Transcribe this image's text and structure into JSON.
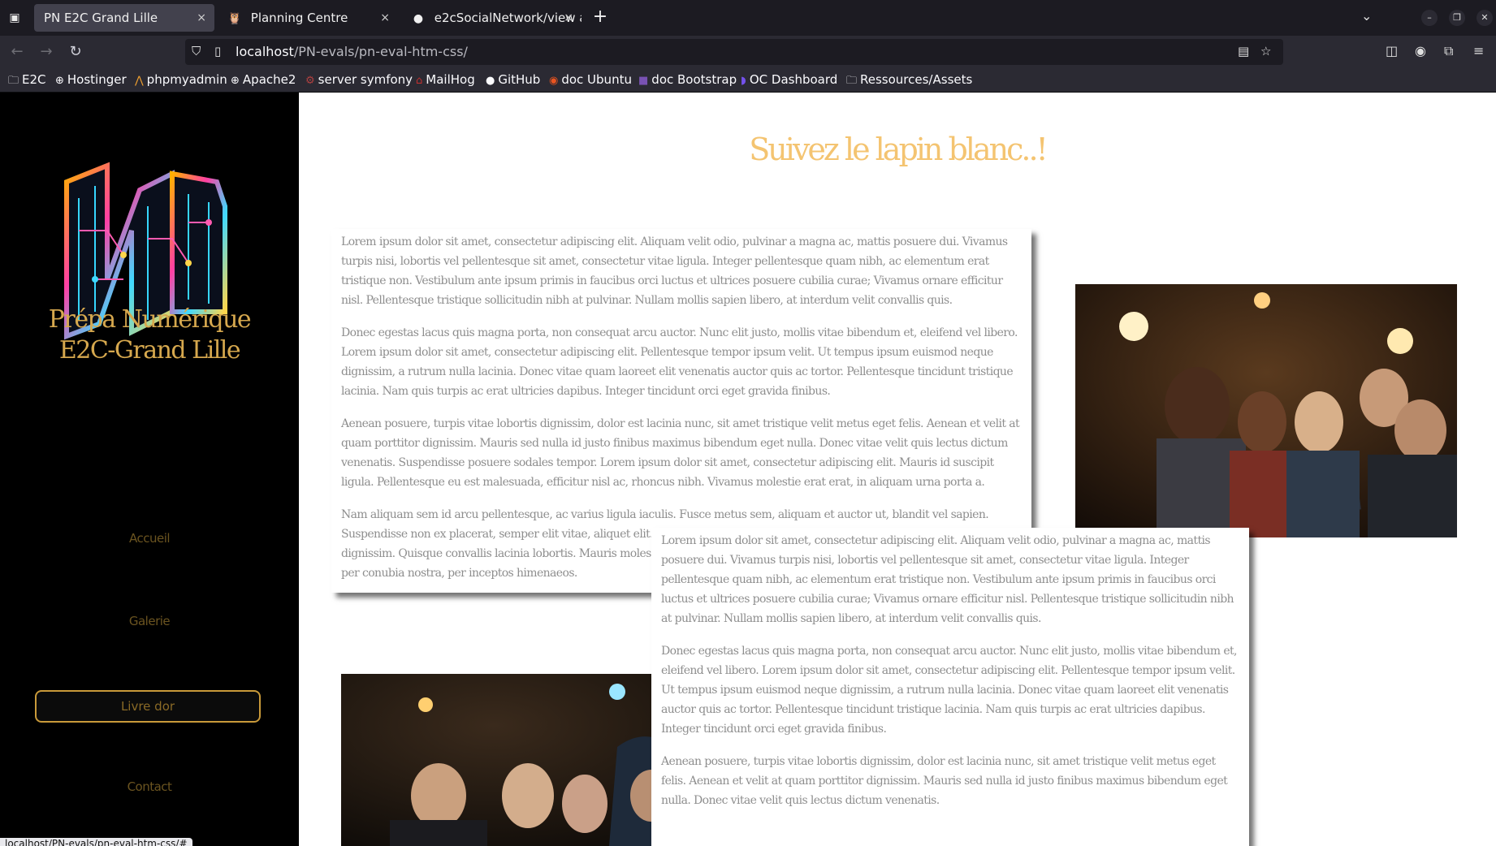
{
  "browser": {
    "tabs": [
      {
        "title": "PN E2C Grand Lille",
        "close": "×"
      },
      {
        "title": "Planning Centre",
        "close": "×"
      },
      {
        "title": "e2cSocialNetwork/view a",
        "close": "×"
      }
    ],
    "new_tab": "+",
    "url_host": "localhost",
    "url_path": "/PN-evals/pn-eval-htm-css/",
    "bookmarks": [
      "E2C",
      "Hostinger",
      "phpmyadmin",
      "Apache2",
      "server symfony",
      "MailHog",
      "GitHub",
      "doc Ubuntu",
      "doc Bootstrap",
      "OC Dashboard",
      "Ressources/Assets"
    ],
    "status_url": "localhost/PN-evals/pn-eval-htm-css/#"
  },
  "sidebar": {
    "brand_line1": "Prépa Numérique",
    "brand_line2": "E2C-Grand Lille",
    "menu": [
      "Accueil",
      "Galerie",
      "Livre dor",
      "Contact"
    ],
    "active_item": "Livre dor"
  },
  "main": {
    "title": "Suivez le lapin blanc..!",
    "card1": [
      "Lorem ipsum dolor sit amet, consectetur adipiscing elit. Aliquam velit odio, pulvinar a magna ac, mattis posuere dui. Vivamus turpis nisi, lobortis vel pellentesque sit amet, consectetur vitae ligula. Integer pellentesque quam nibh, ac elementum erat tristique non. Vestibulum ante ipsum primis in faucibus orci luctus et ultrices posuere cubilia curae; Vivamus ornare efficitur nisl. Pellentesque tristique sollicitudin nibh at pulvinar. Nullam mollis sapien libero, at interdum velit convallis quis.",
      "Donec egestas lacus quis magna porta, non consequat arcu auctor. Nunc elit justo, mollis vitae bibendum et, eleifend vel libero. Lorem ipsum dolor sit amet, consectetur adipiscing elit. Pellentesque tempor ipsum velit. Ut tempus ipsum euismod neque dignissim, a rutrum nulla lacinia. Donec vitae quam laoreet elit venenatis auctor quis ac tortor. Pellentesque tincidunt tristique lacinia. Nam quis turpis ac erat ultricies dapibus. Integer tincidunt orci eget gravida finibus.",
      "Aenean posuere, turpis vitae lobortis dignissim, dolor est lacinia nunc, sit amet tristique velit metus eget felis. Aenean et velit at quam porttitor dignissim. Mauris sed nulla id justo finibus maximus bibendum eget nulla. Donec vitae velit quis lectus dictum venenatis. Suspendisse posuere sodales tempor. Lorem ipsum dolor sit amet, consectetur adipiscing elit. Mauris id suscipit ligula. Pellentesque eu est malesuada, efficitur nisl ac, rhoncus nibh. Vivamus molestie erat erat, in aliquam urna porta a.",
      "Nam aliquam sem id arcu pellentesque, ac varius ligula iaculis. Fusce metus sem, aliquam et auctor ut, blandit vel sapien. Suspendisse non ex placerat, semper elit vitae, aliquet elit. Nulla dignissim at erat vel sagittis. Morbi venenatis pharetra dignissim. Quisque convallis lacinia lobortis. Mauris molestie facilisis rhoncus. Class aptent taciti sociosqu ad litora torquent per conubia nostra, per inceptos himenaeos."
    ],
    "card2": [
      "Lorem ipsum dolor sit amet, consectetur adipiscing elit. Aliquam velit odio, pulvinar a magna ac, mattis posuere dui. Vivamus turpis nisi, lobortis vel pellentesque sit amet, consectetur vitae ligula. Integer pellentesque quam nibh, ac elementum erat tristique non. Vestibulum ante ipsum primis in faucibus orci luctus et ultrices posuere cubilia curae; Vivamus ornare efficitur nisl. Pellentesque tristique sollicitudin nibh at pulvinar. Nullam mollis sapien libero, at interdum velit convallis quis.",
      "Donec egestas lacus quis magna porta, non consequat arcu auctor. Nunc elit justo, mollis vitae bibendum et, eleifend vel libero. Lorem ipsum dolor sit amet, consectetur adipiscing elit. Pellentesque tempor ipsum velit. Ut tempus ipsum euismod neque dignissim, a rutrum nulla lacinia. Donec vitae quam laoreet elit venenatis auctor quis ac tortor. Pellentesque tincidunt tristique lacinia. Nam quis turpis ac erat ultricies dapibus. Integer tincidunt orci eget gravida finibus.",
      "Aenean posuere, turpis vitae lobortis dignissim, dolor est lacinia nunc, sit amet tristique velit metus eget felis. Aenean et velit at quam porttitor dignissim. Mauris sed nulla id justo finibus maximus bibendum eget nulla. Donec vitae velit quis lectus dictum venenatis."
    ]
  },
  "colors": {
    "gold": "#d6a84e",
    "title": "#f4c471",
    "sidebar_bg": "#000000",
    "text_grey": "#8e8e8e"
  }
}
